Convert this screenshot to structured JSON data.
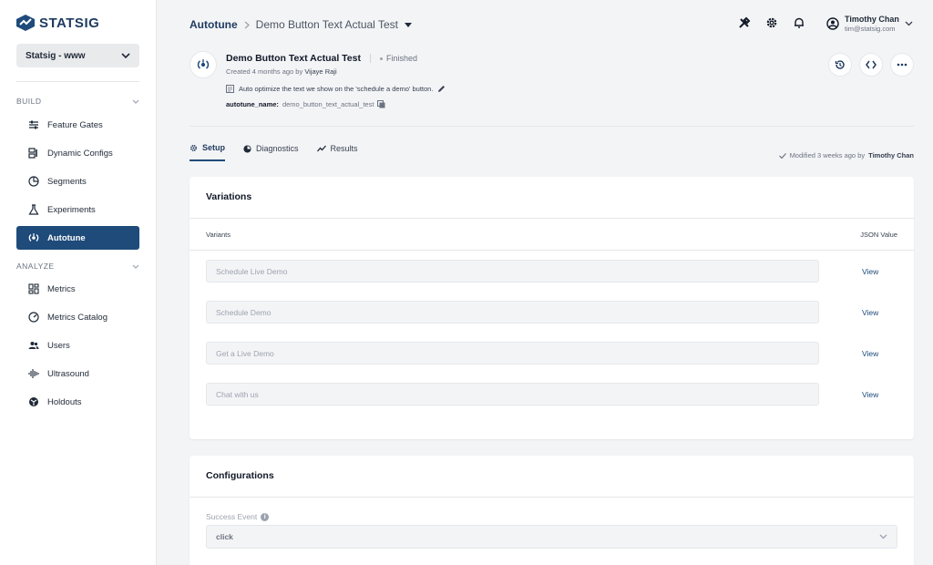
{
  "app": {
    "logo_text": "STATSIG",
    "brand_color": "#1e3a5f",
    "accent_color": "#1e4b7a"
  },
  "sidebar": {
    "project": "Statsig - www",
    "sections": [
      {
        "label": "BUILD"
      },
      {
        "label": "ANALYZE"
      }
    ],
    "build_items": [
      {
        "label": "Feature Gates",
        "icon": "feature-gates-icon"
      },
      {
        "label": "Dynamic Configs",
        "icon": "dynamic-configs-icon"
      },
      {
        "label": "Segments",
        "icon": "segments-icon"
      },
      {
        "label": "Experiments",
        "icon": "flask-icon"
      },
      {
        "label": "Autotune",
        "icon": "autotune-icon",
        "active": true
      }
    ],
    "analyze_items": [
      {
        "label": "Metrics",
        "icon": "metrics-icon"
      },
      {
        "label": "Metrics Catalog",
        "icon": "gauge-icon"
      },
      {
        "label": "Users",
        "icon": "users-icon"
      },
      {
        "label": "Ultrasound",
        "icon": "ultrasound-icon"
      },
      {
        "label": "Holdouts",
        "icon": "holdouts-icon"
      }
    ]
  },
  "header": {
    "breadcrumb_root": "Autotune",
    "breadcrumb_current": "Demo Button Text Actual Test",
    "user": {
      "name": "Timothy Chan",
      "email": "tim@statsig.com"
    }
  },
  "entity": {
    "title": "Demo Button Text Actual Test",
    "status": "Finished",
    "created_prefix": "Created 4 months ago by ",
    "created_by": "Vijaye Raji",
    "description": "Auto optimize the text we show on the 'schedule a demo' button.",
    "key_label": "autotune_name:",
    "key_value": "demo_button_text_actual_test"
  },
  "tabs": [
    {
      "label": "Setup",
      "icon": "gear-icon",
      "active": true
    },
    {
      "label": "Diagnostics",
      "icon": "diagnostics-icon"
    },
    {
      "label": "Results",
      "icon": "results-icon"
    }
  ],
  "modified": {
    "prefix": "Modified 3 weeks ago by ",
    "by": "Timothy Chan"
  },
  "variations": {
    "title": "Variations",
    "col_variants": "Variants",
    "col_json": "JSON Value",
    "rows": [
      {
        "value": "Schedule Live Demo",
        "action": "View"
      },
      {
        "value": "Schedule Demo",
        "action": "View"
      },
      {
        "value": "Get a Live Demo",
        "action": "View"
      },
      {
        "value": "Chat with us",
        "action": "View"
      }
    ]
  },
  "configurations": {
    "title": "Configurations",
    "success_event_label": "Success Event",
    "success_event_value": "click"
  }
}
